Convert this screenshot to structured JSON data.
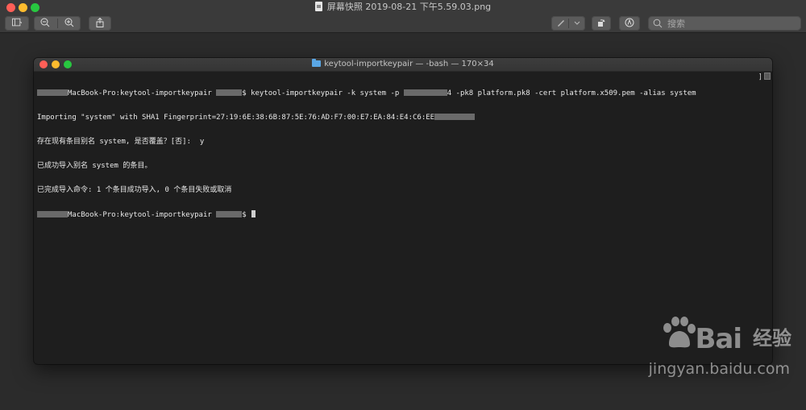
{
  "preview": {
    "window_title": "屏幕快照 2019-08-21 下午5.59.03.png",
    "search_placeholder": "搜索"
  },
  "terminal_window": {
    "title": "keytool-importkeypair — -bash — 170×34",
    "lines": [
      {
        "prefix": "",
        "after_prefix_1": "MacBook-Pro:keytool-importkeypair ",
        "after_redact_2": "$ keytool-importkeypair -k system -p ",
        "after_redact_3": "4 -pk8 platform.pk8 -cert platform.x509.pem -alias system"
      },
      "Importing \"system\" with SHA1 Fingerprint=27:19:6E:38:6B:87:5E:76:AD:F7:00:E7:EA:84:E4:C6:EE",
      "存在现有条目别名 system, 是否覆盖？[否]:  y",
      "已成功导入别名 system 的条目。",
      "已完成导入命令: 1 个条目成功导入, 0 个条目失败或取消",
      {
        "host": "MacBook-Pro:keytool-importkeypair ",
        "prompt": "$ "
      }
    ]
  },
  "watermark": {
    "brand": "Bai",
    "brand_suffix": "经验",
    "url": "jingyan.baidu.com"
  },
  "colors": {
    "background": "#2b2b2b",
    "terminal_bg": "#1e1e1e",
    "terminal_text": "#e8e8e8",
    "close": "#ff5f57",
    "minimize": "#febc2e",
    "zoom": "#28c840"
  }
}
